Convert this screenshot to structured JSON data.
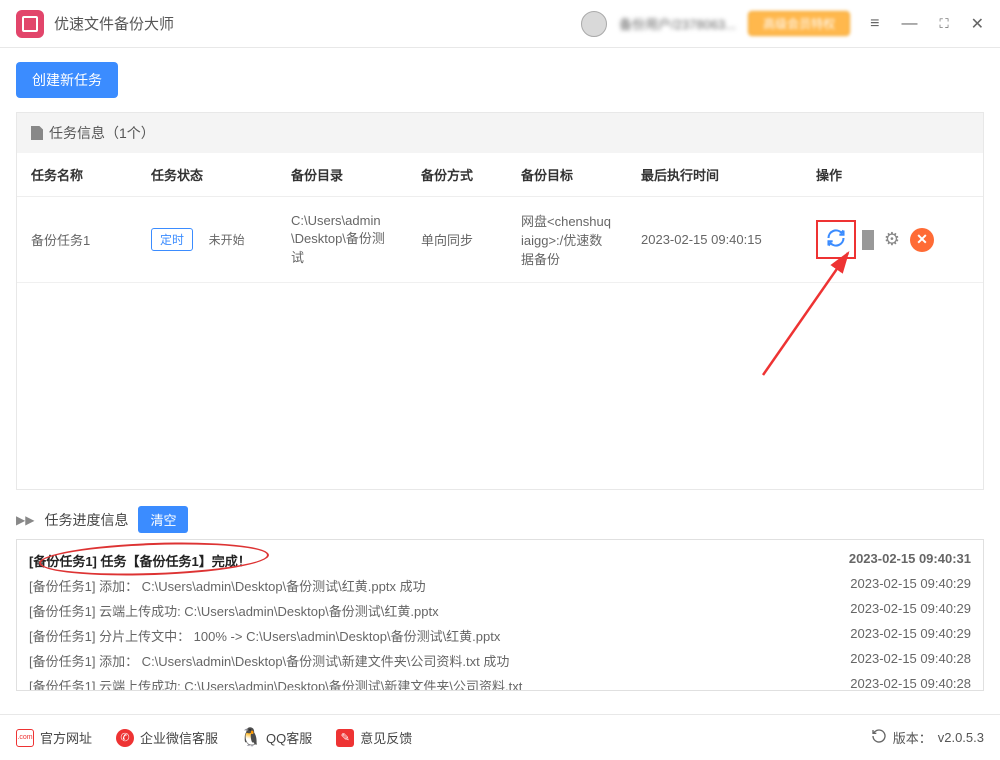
{
  "header": {
    "app_title": "优速文件备份大师",
    "user_label": "备份用户/2378063...",
    "vip_label": "高级会员特权"
  },
  "toolbar": {
    "create_task": "创建新任务"
  },
  "task_panel": {
    "title": "任务信息（1个）"
  },
  "columns": {
    "name": "任务名称",
    "status": "任务状态",
    "dir": "备份目录",
    "method": "备份方式",
    "target": "备份目标",
    "last_run": "最后执行时间",
    "actions": "操作"
  },
  "task": {
    "name": "备份任务1",
    "status_tag": "定时",
    "status_text": "未开始",
    "dir": "C:\\Users\\admin\\Desktop\\备份测试",
    "method": "单向同步",
    "target": "网盘<chenshuqiaigg>:/优速数据备份",
    "last_run": "2023-02-15 09:40:15"
  },
  "progress": {
    "title": "任务进度信息",
    "clear": "清空"
  },
  "logs": [
    {
      "msg": "[备份任务1] 任务【备份任务1】完成！",
      "time": "2023-02-15 09:40:31",
      "bold": true
    },
    {
      "msg": "[备份任务1] 添加： C:\\Users\\admin\\Desktop\\备份测试\\红黄.pptx 成功",
      "time": "2023-02-15 09:40:29",
      "bold": false
    },
    {
      "msg": "[备份任务1] 云端上传成功: C:\\Users\\admin\\Desktop\\备份测试\\红黄.pptx",
      "time": "2023-02-15 09:40:29",
      "bold": false
    },
    {
      "msg": "[备份任务1] 分片上传文中： 100% -> C:\\Users\\admin\\Desktop\\备份测试\\红黄.pptx",
      "time": "2023-02-15 09:40:29",
      "bold": false
    },
    {
      "msg": "[备份任务1] 添加： C:\\Users\\admin\\Desktop\\备份测试\\新建文件夹\\公司资料.txt 成功",
      "time": "2023-02-15 09:40:28",
      "bold": false
    },
    {
      "msg": "[备份任务1] 云端上传成功: C:\\Users\\admin\\Desktop\\备份测试\\新建文件夹\\公司资料.txt",
      "time": "2023-02-15 09:40:28",
      "bold": false
    }
  ],
  "footer": {
    "official": "官方网址",
    "wechat": "企业微信客服",
    "qq": "QQ客服",
    "feedback": "意见反馈",
    "version_label": "版本：",
    "version": "v2.0.5.3"
  }
}
